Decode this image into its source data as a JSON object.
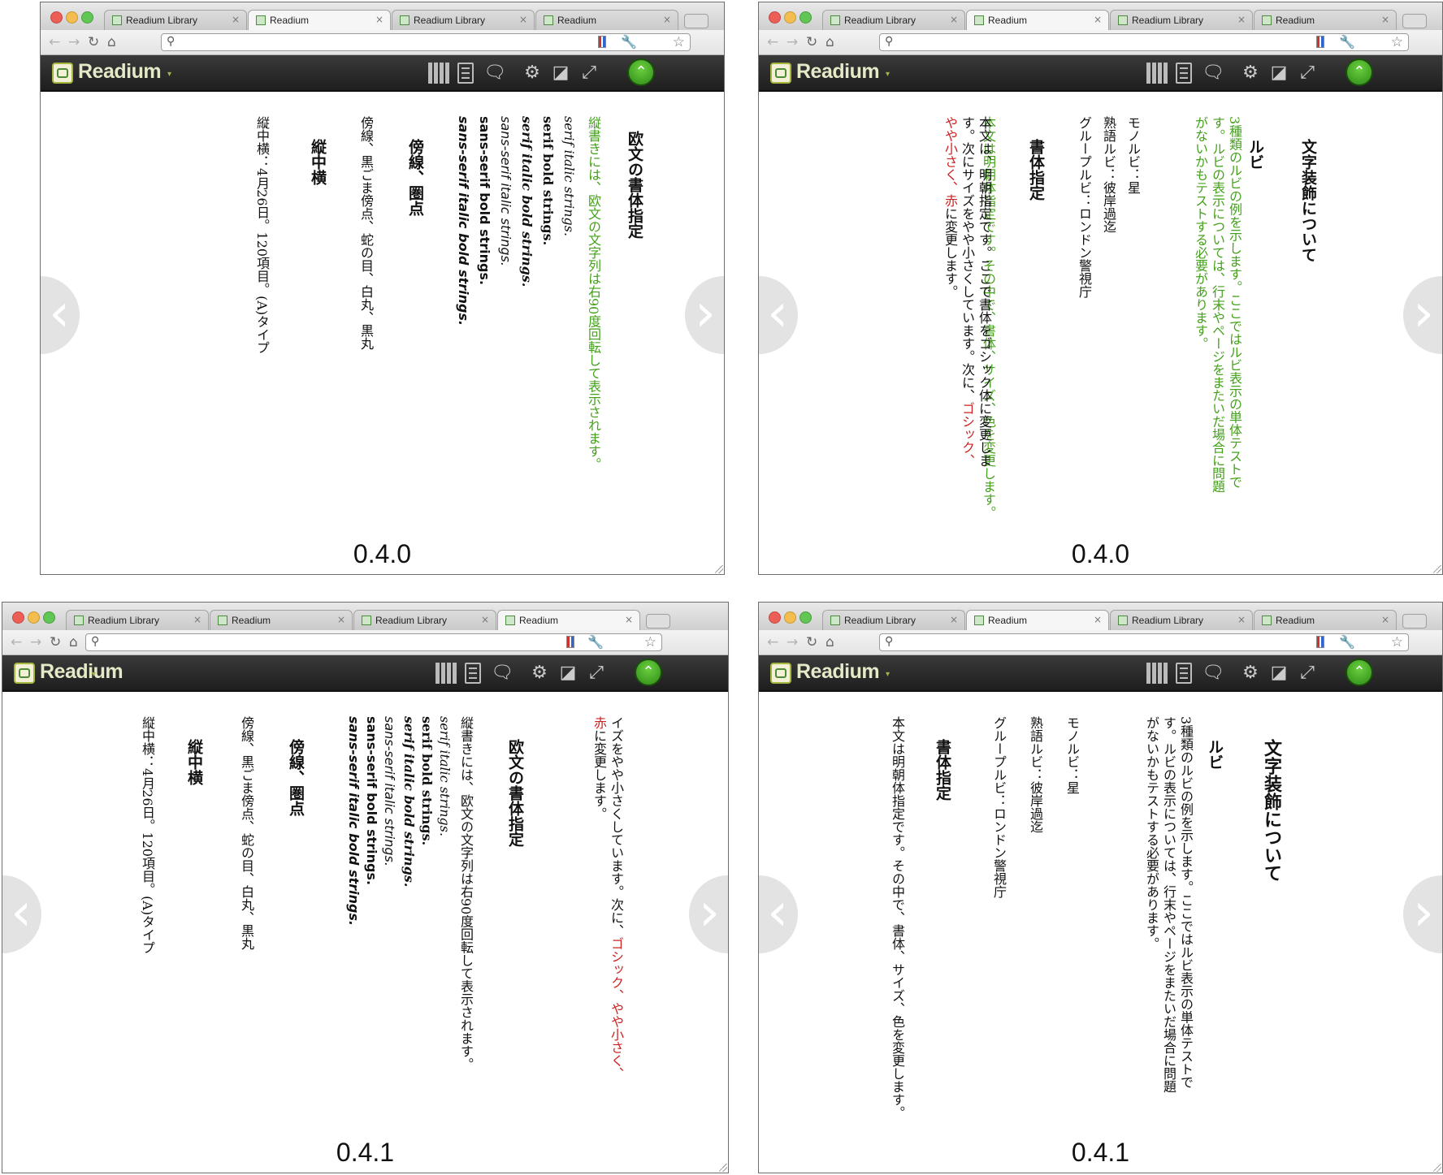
{
  "panels": [
    {
      "tabs": [
        {
          "title": "Readium Library",
          "close": "×"
        },
        {
          "title": "Readium",
          "close": "×"
        },
        {
          "title": "Readium Library",
          "close": "×"
        },
        {
          "title": "Readium",
          "close": "×"
        }
      ],
      "brand": "Readium",
      "version": "0.4.0",
      "paragraphs": [
        "欧文の書体指定",
        "縦書きには、欧文の文字列は右90度回転して表示されます。",
        "serif italic strings.",
        "serif bold strings.",
        "serif italic bold strings.",
        "sans-serif italic strings.",
        "sans-serif bold strings.",
        "sans-serif italic bold strings.",
        "傍線、圏点",
        "傍線、黒ごま傍点、蛇の目、白丸、黒丸",
        "縦中横",
        "縦中横：4月26日。120項目。(A)タイプ"
      ]
    },
    {
      "tabs": [
        {
          "title": "Readium Library",
          "close": "×"
        },
        {
          "title": "Readium",
          "close": "×"
        },
        {
          "title": "Readium Library",
          "close": "×"
        },
        {
          "title": "Readium",
          "close": "×"
        }
      ],
      "brand": "Readium",
      "version": "0.4.0",
      "paragraphs": [
        "文字装飾について",
        "ルビ",
        "3種類のルビの例を示します。ここではルビ表示の単体テストです。ルビの表示については、行末やページをまたいだ場合に問題がないかもテストする必要があります。",
        "モノルビ：星",
        "熟語ルビ：彼岸過迄",
        "グループルビ：ロンドン警視庁",
        "書体指定",
        "本文は明朝体指定です。その中で、書体、サイズ、色を変更します。",
        "本文は、明朝指定です。ここで書体をゴシック体に変更します。次にサイズをやや小さくしています。次に、",
        "ゴシック、やや小さく、赤",
        "に変更します。"
      ]
    },
    {
      "tabs": [
        {
          "title": "Readium Library",
          "close": "×"
        },
        {
          "title": "Readium",
          "close": "×"
        },
        {
          "title": "Readium Library",
          "close": "×"
        },
        {
          "title": "Readium",
          "close": "×"
        }
      ],
      "brand": "Readium",
      "version": "0.4.1",
      "paragraphs": [
        "イズをやや小さくしています。次に、",
        "ゴシック、やや小さく、赤",
        "に変更します。",
        "欧文の書体指定",
        "縦書きには、欧文の文字列は右90度回転して表示されます。",
        "serif italic strings.",
        "serif bold strings.",
        "serif italic bold strings.",
        "sans-serif italic strings.",
        "sans-serif bold strings.",
        "sans-serif italic bold strings.",
        "傍線、圏点",
        "傍線、黒ごま傍点、蛇の目、白丸、黒丸",
        "縦中横",
        "縦中横：4月26日。120項目。(A)タイプ"
      ]
    },
    {
      "tabs": [
        {
          "title": "Readium Library",
          "close": "×"
        },
        {
          "title": "Readium",
          "close": "×"
        },
        {
          "title": "Readium Library",
          "close": "×"
        },
        {
          "title": "Readium",
          "close": "×"
        }
      ],
      "brand": "Readium",
      "version": "0.4.1",
      "paragraphs": [
        "文字装飾について",
        "ルビ",
        "3種類のルビの例を示します。ここではルビ表示の単体テストです。ルビの表示については、行末やページをまたいだ場合に問題がないかもテストする必要があります。",
        "モノルビ：星",
        "熟語ルビ：彼岸過迄",
        "グループルビ：ロンドン警視庁",
        "書体指定",
        "本文は明朝体指定です。その中で、書体、サイズ、色を変更します。"
      ]
    }
  ],
  "icons": {
    "back": "back-arrow-icon",
    "forward": "forward-arrow-icon",
    "reload": "reload-icon",
    "home": "home-icon",
    "search": "search-icon",
    "star": "bookmark-star-icon",
    "wrench": "wrench-icon",
    "library": "library-icon",
    "toc": "toc-icon",
    "tts": "text-to-speech-icon",
    "settings": "gear-icon",
    "contrast": "contrast-icon",
    "fullscreen": "fullscreen-icon",
    "up": "chevron-up-icon",
    "prev": "chevron-left-icon",
    "next": "chevron-right-icon"
  },
  "colors": {
    "accent_green": "#44a11b",
    "highlight_red": "#cc2222",
    "bar_dark": "#262626"
  }
}
